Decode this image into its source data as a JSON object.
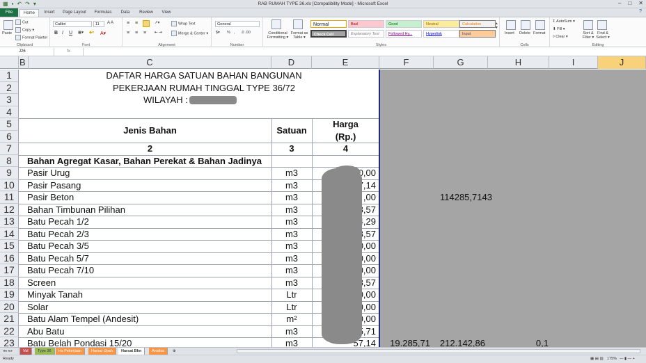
{
  "window": {
    "title": "RAB RUMAH TYPE 36.xls  [Compatibility Mode]  -  Microsoft Excel",
    "min": "–",
    "max": "□",
    "close": "✕"
  },
  "ribbon_tabs": [
    "File",
    "Home",
    "Insert",
    "Page Layout",
    "Formulas",
    "Data",
    "Review",
    "View"
  ],
  "ribbon": {
    "clipboard": {
      "paste": "Paste",
      "cut": "Cut",
      "copy": "Copy ▾",
      "format_painter": "Format Painter",
      "label": "Clipboard"
    },
    "font": {
      "name": "Calibri",
      "size": "11",
      "label": "Font"
    },
    "alignment": {
      "wrap": "Wrap Text",
      "merge": "Merge & Center ▾",
      "label": "Alignment"
    },
    "number": {
      "format": "General",
      "pct": "%",
      "comma": ",",
      "label": "Number"
    },
    "styles": {
      "conditional": "Conditional Formatting ▾",
      "format_table": "Format as Table ▾",
      "normal": "Normal",
      "bad": "Bad",
      "good": "Good",
      "neutral": "Neutral",
      "calculation": "Calculation",
      "check_cell": "Check Cell",
      "explanatory": "Explanatory Text",
      "followed": "Followed Hy...",
      "hyperlink": "Hyperlink",
      "input": "Input",
      "label": "Styles"
    },
    "cells": {
      "insert": "Insert",
      "delete": "Delete",
      "format": "Format",
      "label": "Cells"
    },
    "editing": {
      "autosum": "AutoSum ▾",
      "fill": "Fill ▾",
      "clear": "Clear ▾",
      "sort": "Sort & Filter ▾",
      "find": "Find & Select ▾",
      "label": "Editing"
    }
  },
  "formula_bar": {
    "name_box": "J26",
    "fx": "fx",
    "content": ""
  },
  "columns": [
    "B",
    "C",
    "D",
    "E",
    "F",
    "G",
    "H",
    "I",
    "J"
  ],
  "rows": [
    "1",
    "2",
    "3",
    "4",
    "5",
    "6",
    "7",
    "8",
    "9",
    "10",
    "11",
    "12",
    "13",
    "14",
    "15",
    "16",
    "17",
    "18",
    "19",
    "20",
    "21",
    "22",
    "23"
  ],
  "sheet": {
    "title1": "DAFTAR HARGA SATUAN BAHAN BANGUNAN",
    "title2": "PEKERJAAN RUMAH TINGGAL TYPE 36/72",
    "wilayah": "WILAYAH   :",
    "hdr_jenis": "Jenis Bahan",
    "hdr_satuan": "Satuan",
    "hdr_harga": "Harga",
    "hdr_rp": "(Rp.)",
    "num_2": "2",
    "num_3": "3",
    "num_4": "4",
    "section": "Bahan Agregat Kasar, Bahan Perekat & Bahan Jadinya",
    "items": [
      {
        "name": "Pasir Urug",
        "unit": "m3",
        "price": "0,00"
      },
      {
        "name": "Pasir Pasang",
        "unit": "m3",
        "price": "7,14"
      },
      {
        "name": "Pasir Beton",
        "unit": "m3",
        "price": ",00"
      },
      {
        "name": "Bahan Timbunan Pilihan",
        "unit": "m3",
        "price": "28,57"
      },
      {
        "name": "Batu Pecah 1/2",
        "unit": "m3",
        "price": "14,29"
      },
      {
        "name": "Batu Pecah 2/3",
        "unit": "m3",
        "price": "28,57"
      },
      {
        "name": "Batu Pecah 3/5",
        "unit": "m3",
        "price": "000,00"
      },
      {
        "name": "Batu Pecah 5/7",
        "unit": "m3",
        "price": "00,00"
      },
      {
        "name": "Batu Pecah 7/10",
        "unit": "m3",
        "price": "00,00"
      },
      {
        "name": "Screen",
        "unit": "m3",
        "price": "28,57"
      },
      {
        "name": "Minyak Tanah",
        "unit": "Ltr",
        "price": "00,00"
      },
      {
        "name": "Solar",
        "unit": "Ltr",
        "price": "00,00"
      },
      {
        "name": "Batu Alam Tempel (Andesit)",
        "unit": "m²",
        "price": "00,00"
      },
      {
        "name": "Abu Batu",
        "unit": "m3",
        "price": "285,71"
      },
      {
        "name": "Batu Belah Pondasi 15/20",
        "unit": "m3",
        "price": "57,14"
      }
    ],
    "g11": "114285,7143",
    "f23": "19.285,71",
    "g23": "212.142,86",
    "h23": "0,1"
  },
  "sheet_tabs": [
    "Vol",
    "Type 36",
    "Hs Pekerjaan",
    "Harsat Upah",
    "Harsat Bhn",
    "Analisa"
  ],
  "status": {
    "ready": "Ready",
    "zoom": "175%"
  }
}
